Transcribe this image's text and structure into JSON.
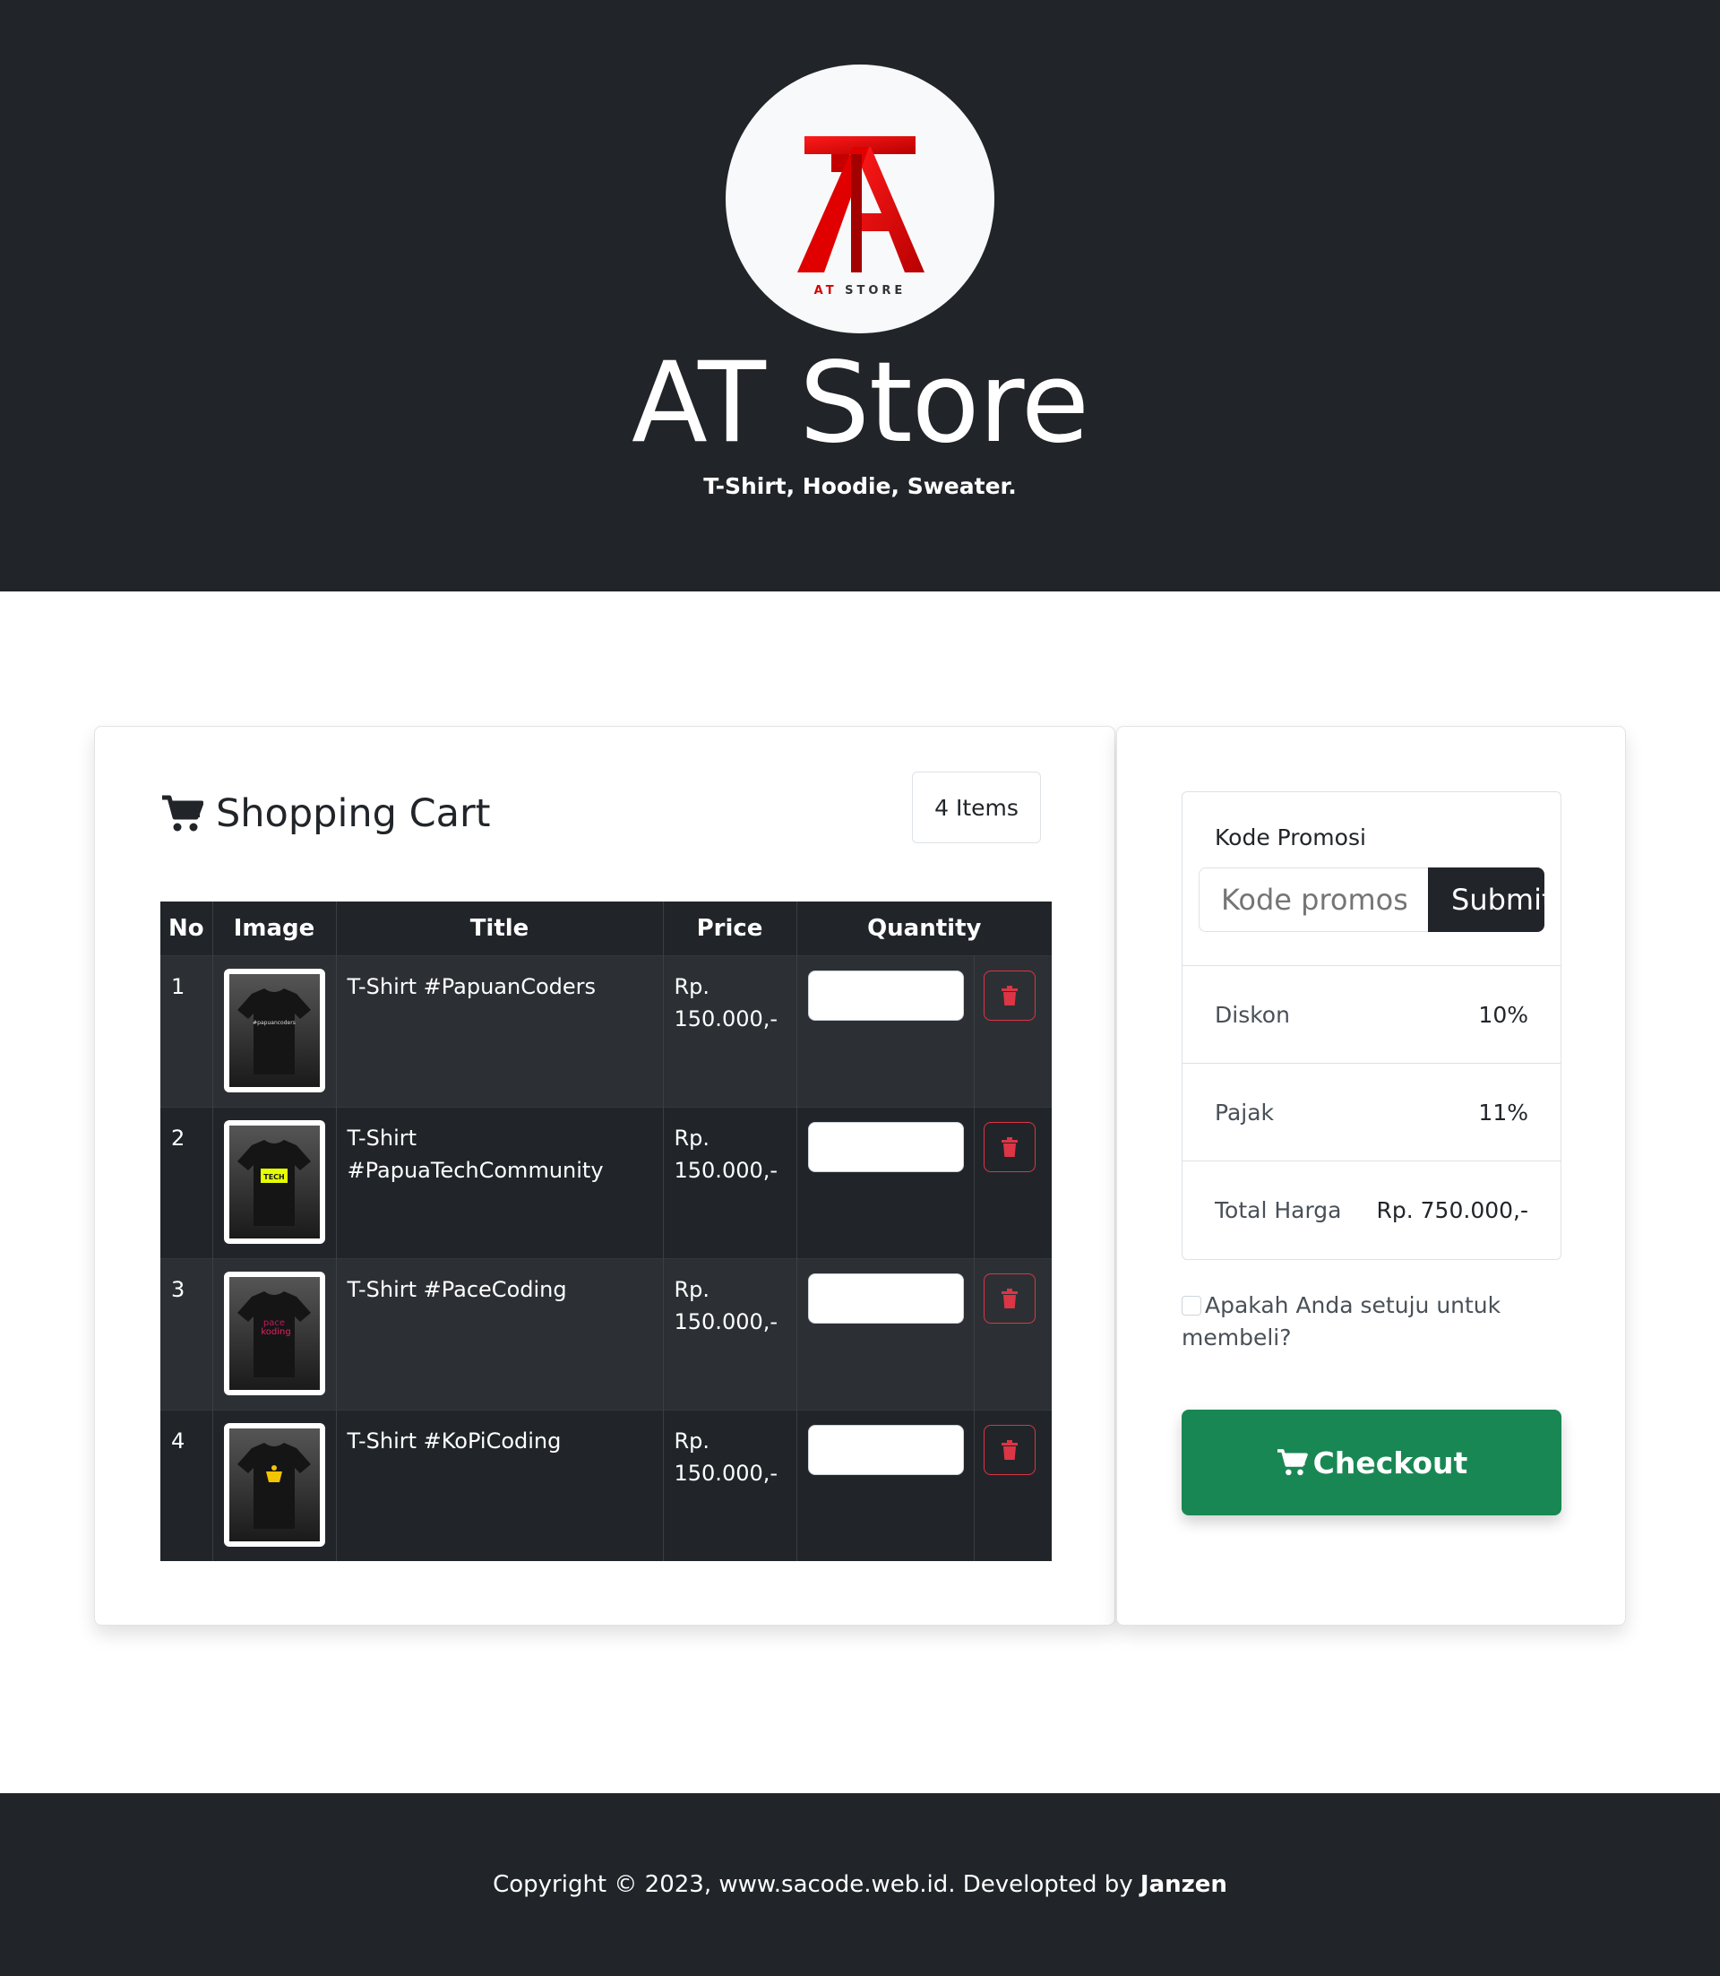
{
  "header": {
    "logo_text_accent": "AT",
    "logo_text_rest": "STORE",
    "title": "AT Store",
    "subtitle": "T-Shirt, Hoodie, Sweater."
  },
  "cart": {
    "heading": "Shopping Cart",
    "items_badge": "4 Items",
    "columns": [
      "No",
      "Image",
      "Title",
      "Price",
      "Quantity"
    ],
    "rows": [
      {
        "no": "1",
        "title": "T-Shirt #PapuanCoders",
        "price": "Rp. 150.000,-",
        "quantity": ""
      },
      {
        "no": "2",
        "title": "T-Shirt #PapuaTechCommunity",
        "price": "Rp. 150.000,-",
        "quantity": ""
      },
      {
        "no": "3",
        "title": "T-Shirt #PaceCoding",
        "price": "Rp. 150.000,-",
        "quantity": ""
      },
      {
        "no": "4",
        "title": "T-Shirt #KoPiCoding",
        "price": "Rp. 150.000,-",
        "quantity": ""
      }
    ]
  },
  "summary": {
    "promo_label": "Kode Promosi",
    "promo_placeholder": "Kode promosi",
    "promo_button": "Submit",
    "discount_label": "Diskon",
    "discount_value": "10%",
    "tax_label": "Pajak",
    "tax_value": "11%",
    "total_label": "Total Harga",
    "total_value": "Rp. 750.000,-",
    "agree_text": "Apakah Anda setuju untuk membeli?",
    "checkout_label": "Checkout"
  },
  "footer": {
    "copyright": "Copyright © 2023, www.sacode.web.id. Developted by",
    "author": "Janzen"
  },
  "colors": {
    "dark": "#212529",
    "success": "#198754",
    "danger": "#dc3545",
    "logo_red": "#e00000"
  }
}
